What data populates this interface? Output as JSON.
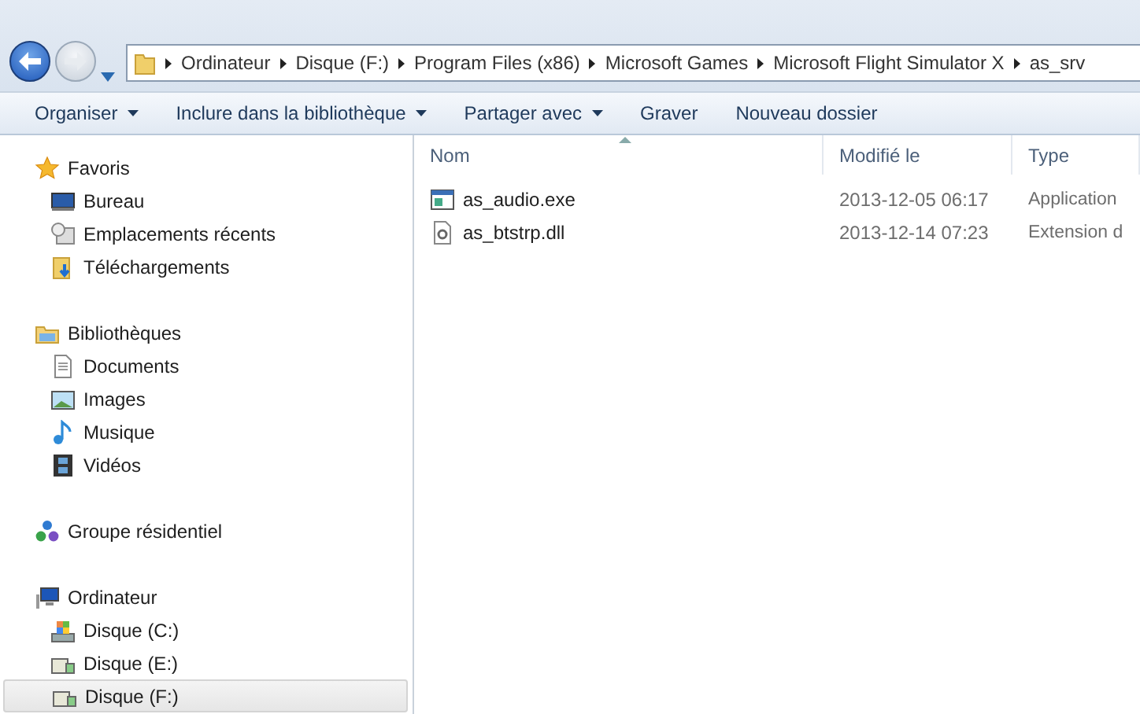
{
  "address_bar": {
    "path": [
      "Ordinateur",
      "Disque (F:)",
      "Program Files (x86)",
      "Microsoft Games",
      "Microsoft Flight Simulator X",
      "as_srv"
    ]
  },
  "toolbar": [
    {
      "label": "Organiser",
      "dropdown": true
    },
    {
      "label": "Inclure dans la bibliothèque",
      "dropdown": true
    },
    {
      "label": "Partager avec",
      "dropdown": true
    },
    {
      "label": "Graver",
      "dropdown": false
    },
    {
      "label": "Nouveau dossier",
      "dropdown": false
    }
  ],
  "sidebar": {
    "groups": [
      {
        "label": "Favoris",
        "kind": "star",
        "children": [
          {
            "label": "Bureau",
            "kind": "desktop",
            "selected": false
          },
          {
            "label": "Emplacements récents",
            "kind": "recent",
            "selected": false
          },
          {
            "label": "Téléchargements",
            "kind": "download",
            "selected": false
          }
        ]
      },
      {
        "label": "Bibliothèques",
        "kind": "library",
        "children": [
          {
            "label": "Documents",
            "kind": "document",
            "selected": false
          },
          {
            "label": "Images",
            "kind": "picture",
            "selected": false
          },
          {
            "label": "Musique",
            "kind": "music",
            "selected": false
          },
          {
            "label": "Vidéos",
            "kind": "video",
            "selected": false
          }
        ]
      },
      {
        "label": "Groupe résidentiel",
        "kind": "homegroup"
      },
      {
        "label": "Ordinateur",
        "kind": "computer",
        "children": [
          {
            "label": "Disque (C:)",
            "kind": "sysdrive",
            "selected": false
          },
          {
            "label": "Disque (E:)",
            "kind": "drive",
            "selected": false
          },
          {
            "label": "Disque (F:)",
            "kind": "drive",
            "selected": true
          }
        ]
      }
    ]
  },
  "table": {
    "columns": [
      "Nom",
      "Modifié le",
      "Type"
    ],
    "rows": [
      {
        "name": "as_audio.exe",
        "kind": "exe",
        "modified": "2013-12-05 06:17",
        "type": "Application"
      },
      {
        "name": "as_btstrp.dll",
        "kind": "dll",
        "modified": "2013-12-14 07:23",
        "type": "Extension d"
      }
    ]
  }
}
